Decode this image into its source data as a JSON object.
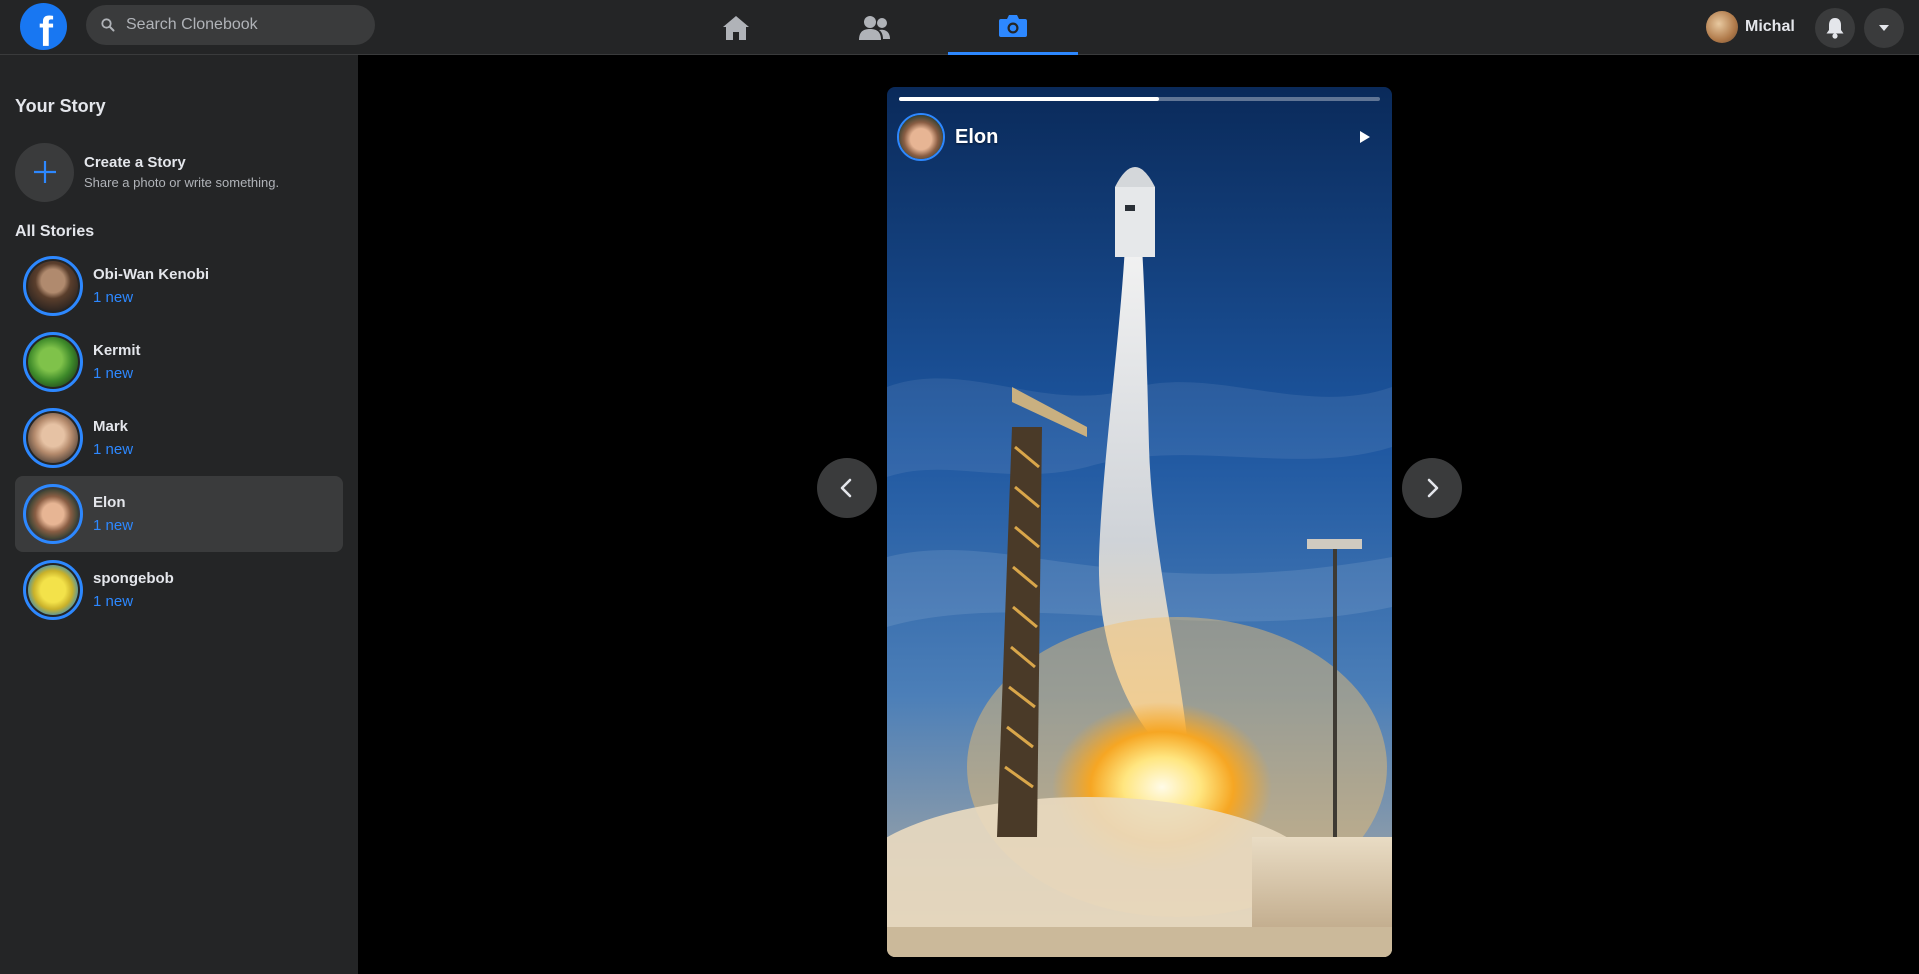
{
  "app": {
    "logo_letter": "f",
    "brand_color": "#1877f2",
    "accent_color": "#2d88ff"
  },
  "search": {
    "placeholder": "Search Clonebook",
    "icon": "search-icon"
  },
  "nav": {
    "tabs": [
      {
        "name": "home",
        "icon": "home-icon",
        "active": false
      },
      {
        "name": "friends",
        "icon": "friends-icon",
        "active": false
      },
      {
        "name": "stories",
        "icon": "camera-icon",
        "active": true
      }
    ]
  },
  "user": {
    "name": "Michal",
    "notifications_icon": "bell-icon",
    "menu_icon": "caret-down-icon"
  },
  "sidebar": {
    "your_story_title": "Your Story",
    "create": {
      "title": "Create a Story",
      "subtitle": "Share a photo or write something.",
      "icon": "plus-icon"
    },
    "all_stories_title": "All Stories",
    "stories": [
      {
        "name": "Obi-Wan Kenobi",
        "count": "1 new",
        "active": false
      },
      {
        "name": "Kermit",
        "count": "1 new",
        "active": false
      },
      {
        "name": "Mark",
        "count": "1 new",
        "active": false
      },
      {
        "name": "Elon",
        "count": "1 new",
        "active": true
      },
      {
        "name": "spongebob",
        "count": "1 new",
        "active": false
      }
    ]
  },
  "viewer": {
    "author": "Elon",
    "progress": 0.54,
    "play_icon": "play-icon",
    "prev_icon": "chevron-left-icon",
    "next_icon": "chevron-right-icon"
  }
}
